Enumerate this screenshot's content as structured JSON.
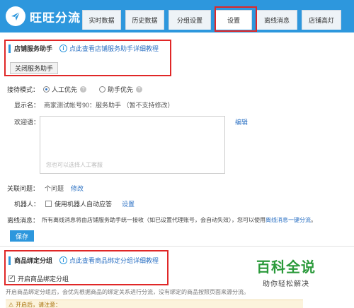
{
  "app": {
    "logo_text": "旺旺分流",
    "brand_color": "#2d97dd"
  },
  "tabs": [
    {
      "label": "实时数据"
    },
    {
      "label": "历史数据"
    },
    {
      "label": "分组设置"
    },
    {
      "label": "设置",
      "active": true
    },
    {
      "label": "离线消息"
    },
    {
      "label": "店铺高灯"
    }
  ],
  "assistant_section": {
    "title": "店铺服务助手",
    "help_link": "点此查看店铺服务助手详细教程",
    "close_button": "关闭服务助手"
  },
  "form": {
    "reception_mode_label": "接待模式：",
    "mode_manual": "人工优先",
    "mode_assistant": "助手优先",
    "selected_mode": "人工优先",
    "display_name_label": "显示名：",
    "display_name_value": "商家测试帐号90：服务助手 （暂不支持修改）",
    "welcome_label": "欢迎语：",
    "edit_link": "编辑",
    "welcome_placeholder": "您也可以选择人工客服",
    "related_label": "关联问题：",
    "related_count": "个问题",
    "related_edit": "修改",
    "robot_label": "机器人：",
    "robot_checkbox": "使用机器人自动应答",
    "robot_settings": "设置",
    "offline_label": "离线消息：",
    "offline_text": "所有离线消息将由店铺服务助手统一接收（如已设置代理账号，会自动失效），您可以使用",
    "offline_link": "离线消息一键分流",
    "offline_end": "。",
    "save_button": "保存"
  },
  "binding_section": {
    "title": "商品绑定分组",
    "help_link": "点此查看商品绑定分组详细教程",
    "checkbox_label": "开启商品绑定分组",
    "note": "开启商品绑定分组后，会优先根据商品的绑定关系进行分流，没有绑定的商品按照页面来源分流。",
    "warning": "开启后，请注意："
  },
  "watermark": {
    "title": "百科全说",
    "subtitle": "助你轻松解决"
  }
}
